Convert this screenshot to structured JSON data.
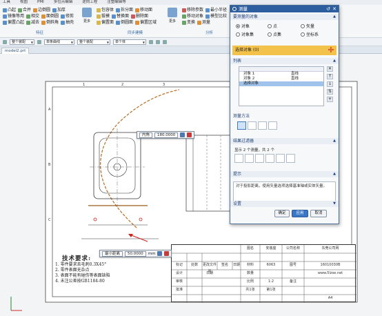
{
  "menu": [
    "工具",
    "视图",
    "PMI",
    "多位点编辑",
    "逆向工程",
    "注塑编辑等"
  ],
  "ribbon": {
    "groups": [
      {
        "caption": "特征",
        "rows": [
          [
            "凸起",
            "合并",
            "边倒圆",
            "加厚"
          ],
          [
            "镜像等用",
            "相交",
            "面倒圆",
            "修剪"
          ],
          [
            "偏置凸起",
            "减去",
            "倒斜角",
            "抽壳"
          ]
        ]
      },
      {
        "caption": "同步建模",
        "rows": [
          [
            "包容体",
            "拆分面",
            "移动面"
          ],
          [
            "拔模",
            "替换面",
            "删除面"
          ],
          [
            "偏置面",
            "倒圆面",
            "偏置区域"
          ]
        ]
      },
      {
        "caption": "分析",
        "rows": [
          [
            "移除参数",
            "最小半径"
          ],
          [
            "移动对象",
            "模型比较"
          ],
          [
            "变换",
            "测量"
          ]
        ]
      }
    ],
    "big_buttons": [
      {
        "label": "更多"
      },
      {
        "label": "更多"
      }
    ]
  },
  "filter_bar": {
    "combo1": "整个装配",
    "combo2": "单条曲线",
    "combo3": "整个装配",
    "combo4": "单个体"
  },
  "doc_tab": {
    "label": "model2.prt"
  },
  "drawing": {
    "tech_title": "技术要求:",
    "tech_lines": [
      "1. 零件要求去毛刺0.3X45°",
      "2. 零件表面无杂点",
      "3. 表面不能有碰伤等表面缺陷",
      "4. 未注公差按GB1184-80"
    ],
    "sheet_top_numbers": [
      "1",
      "2",
      "3",
      "4",
      "5"
    ],
    "sheet_side_letters": [
      "A",
      "B",
      "C",
      "D"
    ],
    "title_block": {
      "cells": [
        "图名",
        "安装座",
        "公司名称",
        "东莞公司网",
        "标记",
        "处数",
        "更改文件号",
        "签名",
        "日期",
        "材料",
        "6063",
        "图号",
        "设计",
        "日期",
        "数量",
        "",
        "www.5lzxe.net",
        "审核",
        "",
        "比例",
        "1:2",
        "备注",
        "批准",
        "",
        "共1张",
        "第1张",
        "16010030B",
        "A4"
      ]
    },
    "zoom_label": "A4"
  },
  "popups": {
    "angle": {
      "type": "内角",
      "value": "180.0000"
    },
    "dist": {
      "type": "最小距离",
      "value": "50.0000",
      "unit": "mm"
    }
  },
  "dialog": {
    "title": "测量",
    "section_objects": "要测量的对象",
    "radios": [
      {
        "label": "对象",
        "on": true
      },
      {
        "label": "点",
        "on": false
      },
      {
        "label": "矢量",
        "on": false
      },
      {
        "label": "对象集",
        "on": false
      },
      {
        "label": "点集",
        "on": false
      },
      {
        "label": "坐标系",
        "on": false
      }
    ],
    "select_label": "选择对象 (0)",
    "section_list": "列表",
    "list_header": "",
    "list_rows": [
      {
        "name": "对象 1",
        "type": "直线",
        "sel": false
      },
      {
        "name": "对象 2",
        "type": "直线",
        "sel": false
      },
      {
        "name": "选择对象",
        "type": "",
        "sel": true
      }
    ],
    "section_method": "测量方法",
    "section_results": "结果过滤器",
    "results_text": "显示 2 个测量，共 2 个",
    "section_hint": "提示",
    "hint_text": "对于投影距离，使用矢量选项选择基准轴或实体矢量。",
    "section_settings": "设置",
    "btn_ok": "确定",
    "btn_apply": "应用",
    "btn_cancel": "取消"
  }
}
